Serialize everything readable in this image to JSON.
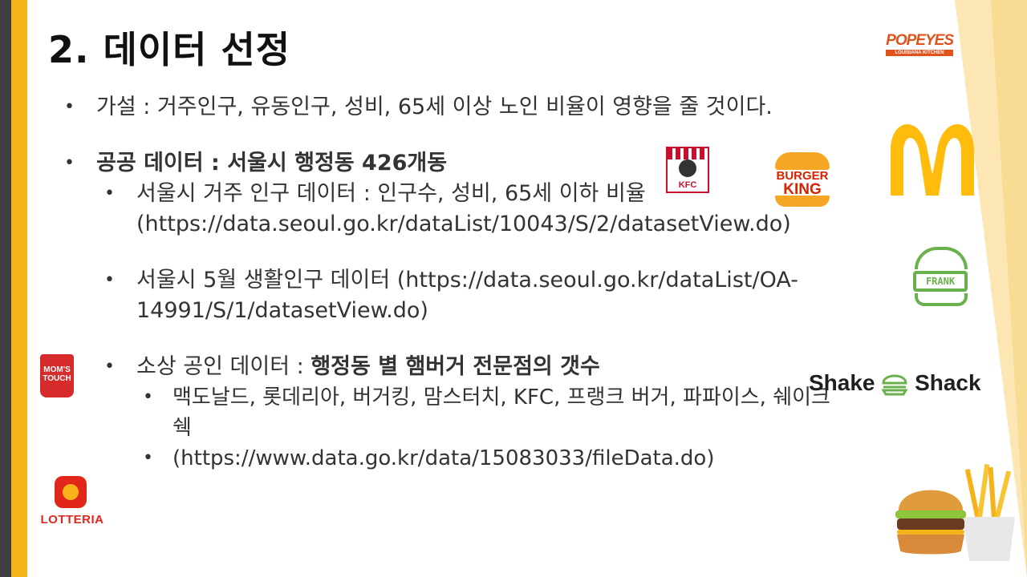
{
  "title": "2. 데이터 선정",
  "bullets": {
    "hypothesis": "가설 : 거주인구, 유동인구, 성비, 65세 이상 노인 비율이 영향을 줄 것이다.",
    "public_data_title": "공공 데이터 : 서울시 행정동 426개동",
    "sub": {
      "resident_pre": "서울시 거주 인구 데이터 : 인구수, 성비, 65세 이하 비율(https://data.seoul.go.kr/dataList/10043/S/2/datasetView.do)",
      "living": "서울시 5월 생활인구 데이터 (https://data.seoul.go.kr/dataList/OA-14991/S/1/datasetView.do)",
      "shop_pre": "소상 공인 데이터 : ",
      "shop_bold": "행정동 별 햄버거 전문점의 갯수",
      "brands": "맥도날드, 롯데리아, 버거킹, 맘스터치, KFC, 프랭크 버거, 파파이스, 쉐이크쉑",
      "shop_url": "(https://www.data.go.kr/data/15083033/fileData.do)"
    }
  },
  "logos": {
    "popeyes": "POPEYES",
    "popeyes_sub": "LOUISIANA KITCHEN",
    "kfc": "KFC",
    "bk_1": "BURGER",
    "bk_2": "KING",
    "frank": "FRANK",
    "moms": "MOM'S TOUCH",
    "shake_1": "Shake",
    "shake_2": "Shack",
    "lotteria": "LOTTERIA"
  },
  "colors": {
    "gold": "#f5b21a",
    "dark": "#3f3f3f",
    "mcd": "#ffbc0d",
    "frank_green": "#6ab04c"
  }
}
